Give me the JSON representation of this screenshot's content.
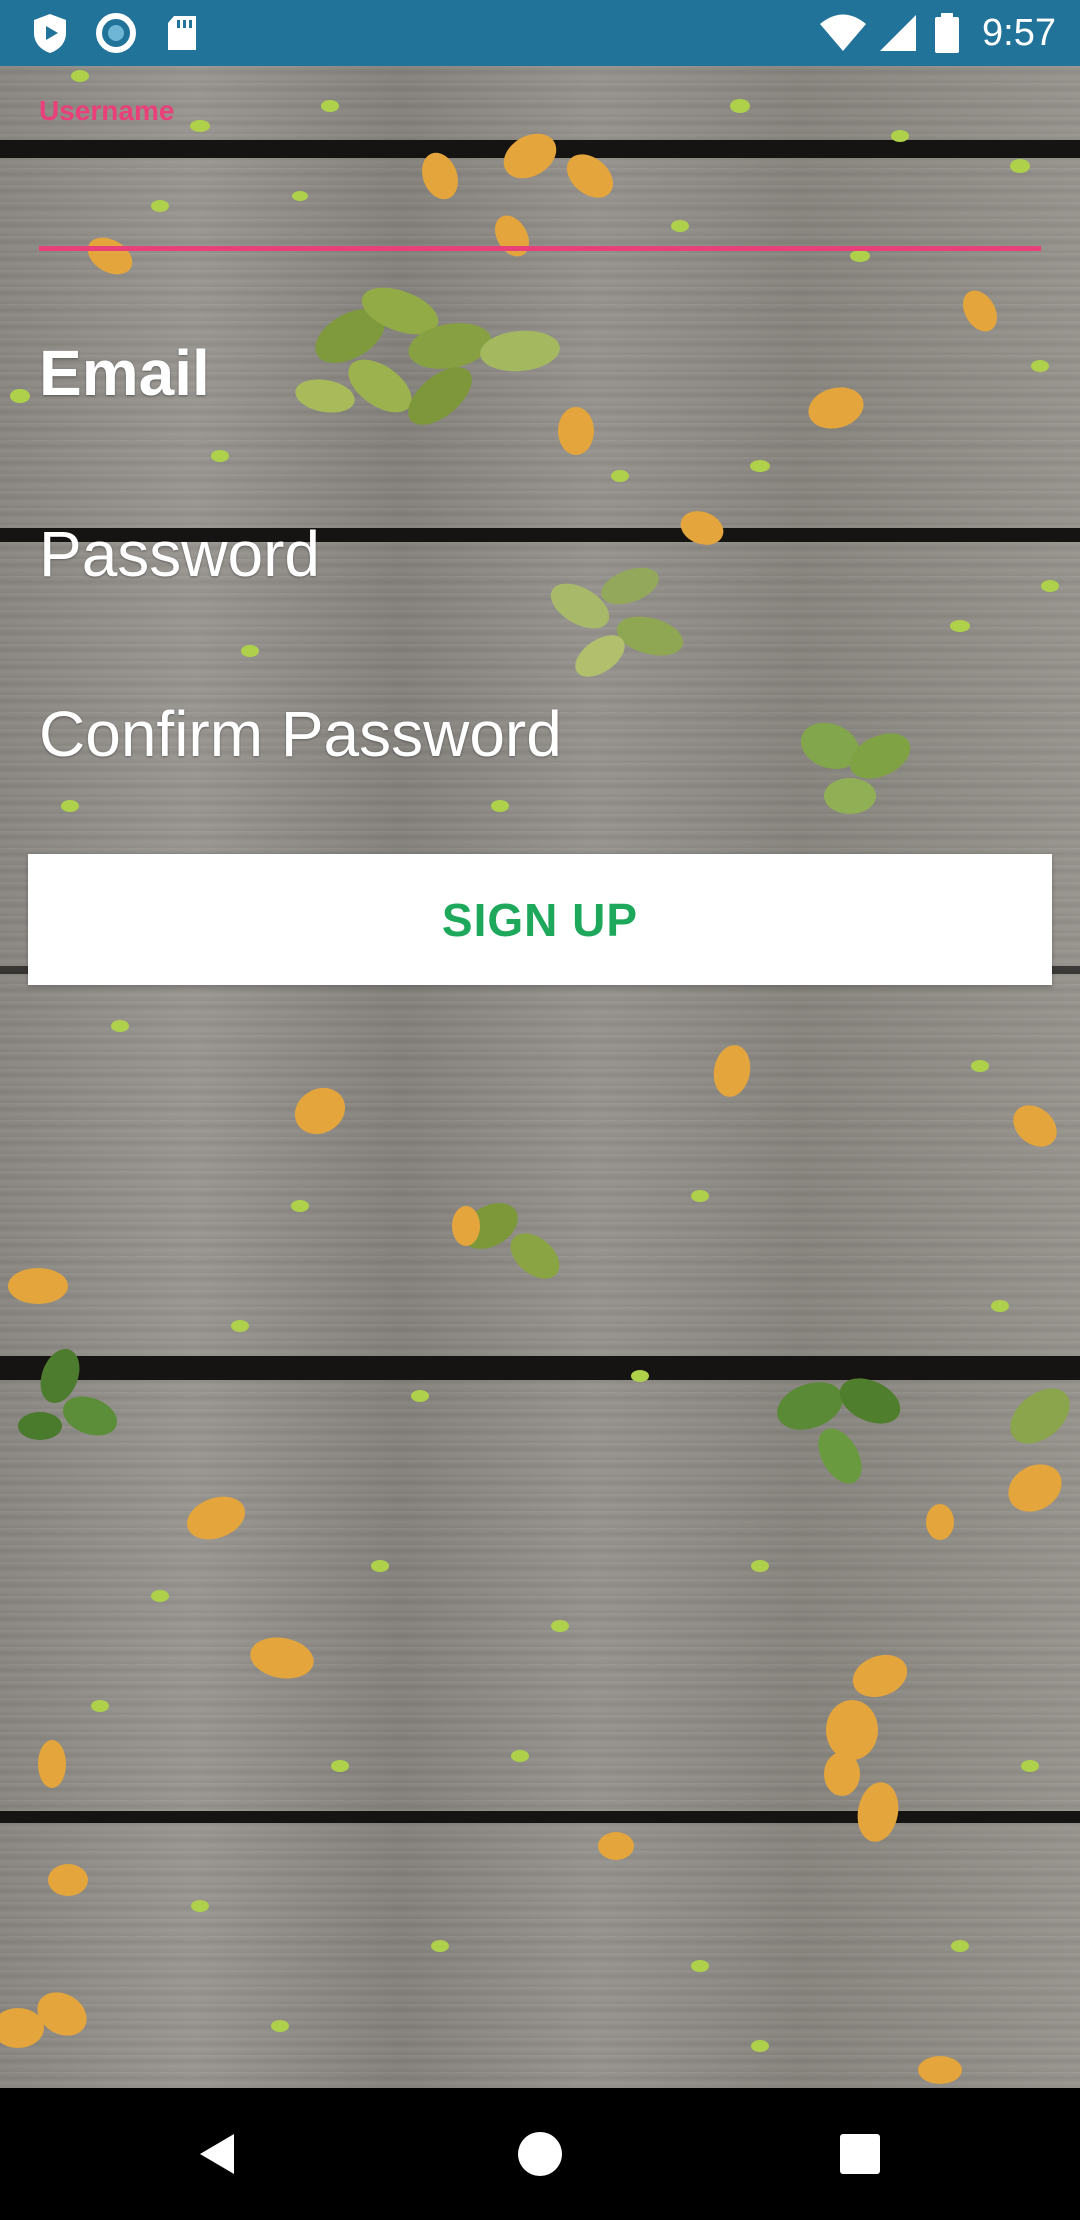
{
  "status_bar": {
    "time": "9:57",
    "icons": [
      "play-protect-icon",
      "circle-sync-icon",
      "sd-card-icon",
      "wifi-icon",
      "signal-icon",
      "battery-icon"
    ],
    "background": "#21739a"
  },
  "form": {
    "username": {
      "label": "Username",
      "value": ""
    },
    "email": {
      "hint": "Email"
    },
    "password": {
      "hint": "Password"
    },
    "confirm_password": {
      "hint": "Confirm Password"
    },
    "signup_label": "SIGN UP"
  },
  "colors": {
    "accent": "#e9407a",
    "button_text": "#1ea85b",
    "button_bg": "#ffffff"
  },
  "nav_bar": {
    "icons": [
      "back-icon",
      "home-icon",
      "recents-icon"
    ]
  }
}
